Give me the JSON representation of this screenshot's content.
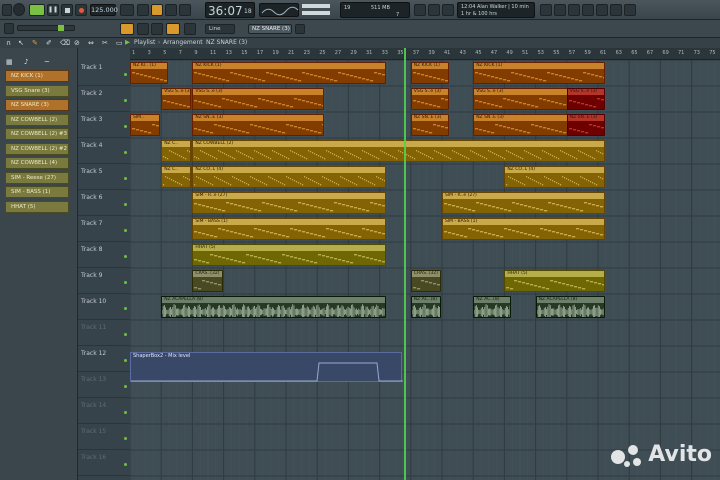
{
  "transport": {
    "tempo": "125.000",
    "time": "36:07",
    "time_sub": "18",
    "pattern_label": "NZ SNARE (3)",
    "snap": "Line",
    "cpu": "19",
    "mem": "511 MB",
    "ram_sub": "7",
    "hint_line1": "12:04 Alan Walker | 10 min",
    "hint_line2": "1 hr & 100 hrs"
  },
  "breadcrumb": {
    "window": "Playlist",
    "section": "Arrangement",
    "current": "NZ SNARE (3)"
  },
  "channels": [
    {
      "label": "NZ KICK (1)",
      "selected": true
    },
    {
      "label": "VSG Snare (3)",
      "selected": false
    },
    {
      "label": "NZ SNARE (3)",
      "selected": true
    },
    {
      "label": "NZ COWBELL (2)",
      "selected": false
    },
    {
      "label": "NZ COWBELL (2) #3",
      "selected": false
    },
    {
      "label": "NZ COWBELL (2) #2",
      "selected": false
    },
    {
      "label": "NZ COWBELL (4)",
      "selected": false
    },
    {
      "label": "SIM - Reese (27)",
      "selected": false
    },
    {
      "label": "SIM - BASS (1)",
      "selected": false
    },
    {
      "label": "HHAT (5)",
      "selected": false
    }
  ],
  "tracks": [
    "Track 1",
    "Track 2",
    "Track 3",
    "Track 4",
    "Track 5",
    "Track 6",
    "Track 7",
    "Track 8",
    "Track 9",
    "Track 10",
    "Track 11",
    "Track 12",
    "Track 13",
    "Track 14",
    "Track 15",
    "Track 16"
  ],
  "ruler": [
    "1",
    "3",
    "5",
    "7",
    "9",
    "11",
    "13",
    "15",
    "17",
    "19",
    "21",
    "23",
    "25",
    "27",
    "29",
    "31",
    "33",
    "35",
    "37",
    "39",
    "41",
    "43",
    "45",
    "47",
    "49",
    "51",
    "53",
    "55",
    "57",
    "59",
    "61",
    "63",
    "65",
    "67",
    "69",
    "71",
    "73",
    "75"
  ],
  "clips": [
    {
      "track": 0,
      "start": 1,
      "len": 5,
      "label": "NZ KI.. (1)",
      "color": "#c9822a"
    },
    {
      "track": 0,
      "start": 9,
      "len": 25,
      "label": "NZ KICK (1)",
      "color": "#c9822a"
    },
    {
      "track": 0,
      "start": 37,
      "len": 5,
      "label": "NZ KICK (1)",
      "color": "#c9822a"
    },
    {
      "track": 0,
      "start": 45,
      "len": 17,
      "label": "NZ KICK (1)",
      "color": "#c9822a"
    },
    {
      "track": 1,
      "start": 5,
      "len": 4,
      "label": "VSG S..e (3)",
      "color": "#c9822a"
    },
    {
      "track": 1,
      "start": 9,
      "len": 17,
      "label": "VSG S..e (3)",
      "color": "#c9822a"
    },
    {
      "track": 1,
      "start": 37,
      "len": 5,
      "label": "VSG S..e (3)",
      "color": "#c9822a"
    },
    {
      "track": 1,
      "start": 45,
      "len": 13,
      "label": "VSG S..e (3)",
      "color": "#c9822a"
    },
    {
      "track": 1,
      "start": 57,
      "len": 5,
      "label": "VSG S..e (3)",
      "color": "#b5342a"
    },
    {
      "track": 2,
      "start": 1,
      "len": 4,
      "label": "SIM..",
      "color": "#c9822a"
    },
    {
      "track": 2,
      "start": 9,
      "len": 17,
      "label": "NZ SN..E (3)",
      "color": "#c9822a"
    },
    {
      "track": 2,
      "start": 37,
      "len": 5,
      "label": "NZ SN..E (3)",
      "color": "#c9822a"
    },
    {
      "track": 2,
      "start": 45,
      "len": 13,
      "label": "NZ SN..E (3)",
      "color": "#c9822a"
    },
    {
      "track": 2,
      "start": 57,
      "len": 5,
      "label": "NZ SN..E (3)",
      "color": "#b5342a"
    },
    {
      "track": 3,
      "start": 5,
      "len": 4,
      "label": "NZ C..",
      "color": "#c9a94a"
    },
    {
      "track": 3,
      "start": 9,
      "len": 53,
      "label": "NZ COWBELL (2)",
      "color": "#c9a94a"
    },
    {
      "track": 4,
      "start": 5,
      "len": 4,
      "label": "NZ C..",
      "color": "#c9a94a"
    },
    {
      "track": 4,
      "start": 9,
      "len": 25,
      "label": "NZ CO..L (4)",
      "color": "#c9a94a"
    },
    {
      "track": 4,
      "start": 49,
      "len": 13,
      "label": "NZ CO..L (4)",
      "color": "#c9a94a"
    },
    {
      "track": 5,
      "start": 9,
      "len": 25,
      "label": "SIM - R..e (27)",
      "color": "#c9a94a"
    },
    {
      "track": 5,
      "start": 41,
      "len": 21,
      "label": "SIM - R..e (27)",
      "color": "#c9a94a"
    },
    {
      "track": 6,
      "start": 9,
      "len": 25,
      "label": "SIM - BASS (1)",
      "color": "#c9a94a"
    },
    {
      "track": 6,
      "start": 41,
      "len": 21,
      "label": "SIM - BASS (1)",
      "color": "#c9a94a"
    },
    {
      "track": 7,
      "start": 9,
      "len": 25,
      "label": "HHAT (5)",
      "color": "#b5ad4a"
    },
    {
      "track": 8,
      "start": 9,
      "len": 4,
      "label": "CRAS..(32)",
      "color": "#8f8f6a"
    },
    {
      "track": 8,
      "start": 37,
      "len": 4,
      "label": "CRAS..(32)",
      "color": "#8f8f6a"
    },
    {
      "track": 8,
      "start": 49,
      "len": 13,
      "label": "HHAT (5)",
      "color": "#b5ad4a"
    },
    {
      "track": 9,
      "start": 5,
      "len": 29,
      "label": "NZ ACAPELLA (8)",
      "color": "#6b7f6a"
    },
    {
      "track": 9,
      "start": 37,
      "len": 4,
      "label": "NZ AC..(8)",
      "color": "#6b7f6a"
    },
    {
      "track": 9,
      "start": 45,
      "len": 5,
      "label": "NZ AC..(8)",
      "color": "#6b7f6a"
    },
    {
      "track": 9,
      "start": 53,
      "len": 9,
      "label": "NZ ACAPELLA (8)",
      "color": "#6b7f6a"
    }
  ],
  "automation": {
    "label": "ShaperBox2 - Mix level"
  }
}
